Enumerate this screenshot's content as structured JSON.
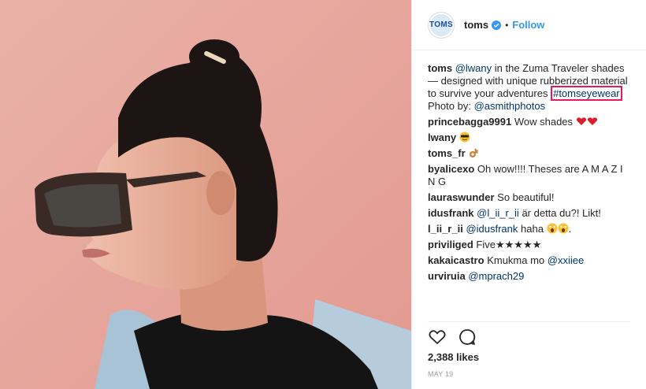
{
  "author": {
    "username": "toms",
    "avatar_text": "TOMS",
    "follow_label": "Follow",
    "separator": "•"
  },
  "caption": {
    "username": "toms",
    "mention": "@lwany",
    "text": "in the Zuma Traveler shades — designed with unique rubberized material to survive your adventures",
    "hashtag": "#tomseyewear",
    "photo_by_label": "Photo by:",
    "photo_by": "@asmithphotos"
  },
  "comments": [
    {
      "user": "princebagga9991",
      "text": "Wow shades",
      "emoji": "hearts"
    },
    {
      "user": "lwany",
      "text": "",
      "emoji": "cool-face"
    },
    {
      "user": "toms_fr",
      "text": "",
      "emoji": "ok-hand"
    },
    {
      "user": "byalicexo",
      "text": "Oh wow!!!! Theses are A M A Z I N G",
      "emoji": ""
    },
    {
      "user": "lauraswunder",
      "text": "So beautiful!",
      "emoji": ""
    },
    {
      "user": "idusfrank",
      "mention": "@l_ii_r_ii",
      "text": "är detta du?! Likt!",
      "emoji": ""
    },
    {
      "user": "l_ii_r_ii",
      "mention": "@idusfrank",
      "text": "haha",
      "emoji": "screaming",
      "suffix": "."
    },
    {
      "user": "priviliged",
      "text": "Five★★★★★",
      "emoji": ""
    },
    {
      "user": "kakaicastro",
      "text": "Kmukma mo",
      "mention_after": "@xxiiee",
      "emoji": ""
    },
    {
      "user": "urviruia",
      "mention": "@mprach29",
      "text": "",
      "emoji": ""
    }
  ],
  "likes": "2,388 likes",
  "date": "MAY 19",
  "icons": [
    "verified-badge-icon",
    "heart-icon",
    "comment-icon"
  ],
  "colors": {
    "link": "#003569",
    "follow": "#3897f0",
    "highlight": "#e5195c",
    "photo_bg": "#e9a9a0"
  }
}
